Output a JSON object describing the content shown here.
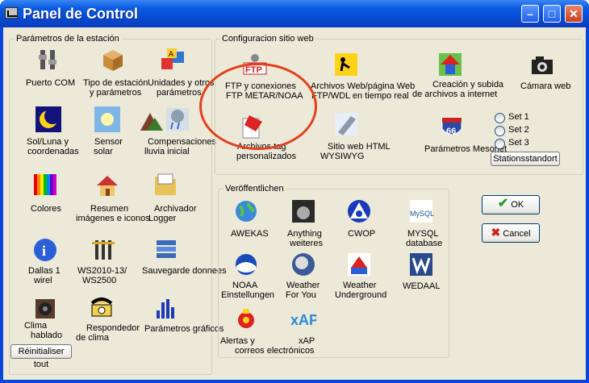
{
  "window": {
    "title": "Panel de Control"
  },
  "groups": {
    "station": "Parámetros de la estación",
    "site": "Configuracion sitio web",
    "publish": "Veröffentlichen"
  },
  "station_items": [
    {
      "label1": "Puerto COM",
      "label2": ""
    },
    {
      "label1": "Tipo de estación",
      "label2": "y parámetros"
    },
    {
      "label1": "Unidades y otros",
      "label2": "parámetros"
    },
    {
      "label1": "Sol/Luna y",
      "label2": "coordenadas"
    },
    {
      "label1": "Sensor",
      "label2": "solar"
    },
    {
      "label1": "Compensaciones",
      "label2": "lluvia inicial"
    },
    {
      "label1": "Colores",
      "label2": ""
    },
    {
      "label1": "Resumen",
      "label2": "imágenes e iconos"
    },
    {
      "label1": "Archivador",
      "label2": "Logger"
    },
    {
      "label1": "Dallas 1",
      "label2": "wirel"
    },
    {
      "label1": "WS2010-13/",
      "label2": "WS2500"
    },
    {
      "label1": "Sauvegarde donnees",
      "label2": ""
    },
    {
      "label1": "Clima",
      "label2": "hablado"
    },
    {
      "label1": "Respondedor",
      "label2": "de clima"
    },
    {
      "label1": "Parámetros gráficos",
      "label2": ""
    }
  ],
  "reset_button": "Réinitialiser tout",
  "site_items": [
    {
      "label1": "FTP y conexiones",
      "label2": "FTP METAR/NOAA"
    },
    {
      "label1": "Archivos Web/página Web",
      "label2": "FTP/WDL en tiempo real"
    },
    {
      "label1": "Creación y subida",
      "label2": "de archivos a internet"
    },
    {
      "label1": "Cámara web",
      "label2": ""
    },
    {
      "label1": "Archivos tag",
      "label2": "personalizados"
    },
    {
      "label1": "Sitio web HTML",
      "label2": "WYSIWYG"
    },
    {
      "label1": "Parámetros Mesonet",
      "label2": ""
    }
  ],
  "sets": [
    "Set 1",
    "Set 2",
    "Set 3"
  ],
  "stationsstandort_button": "Stationsstandort",
  "publish_items": [
    {
      "label1": "AWEKAS",
      "label2": ""
    },
    {
      "label1": "Anything",
      "label2": "weiteres"
    },
    {
      "label1": "CWOP",
      "label2": ""
    },
    {
      "label1": "MYSQL",
      "label2": "database"
    },
    {
      "label1": "NOAA",
      "label2": "Einstellungen"
    },
    {
      "label1": "Weather",
      "label2": "For You"
    },
    {
      "label1": "Weather",
      "label2": "Underground"
    },
    {
      "label1": "WEDAAL",
      "label2": ""
    },
    {
      "label1": "Alertas y",
      "label2": "correos electrónicos"
    },
    {
      "label1": "xAP",
      "label2": ""
    }
  ],
  "icon_texts": {
    "ftp": "FTP",
    "xap": "xAP",
    "route66": "66",
    "mysql": "MySQL"
  },
  "ok_button": "OK",
  "cancel_button": "Cancel",
  "colors": {
    "titlebar": "#0a5be0",
    "face": "#ece9d8",
    "annotation": "#e2401e"
  }
}
